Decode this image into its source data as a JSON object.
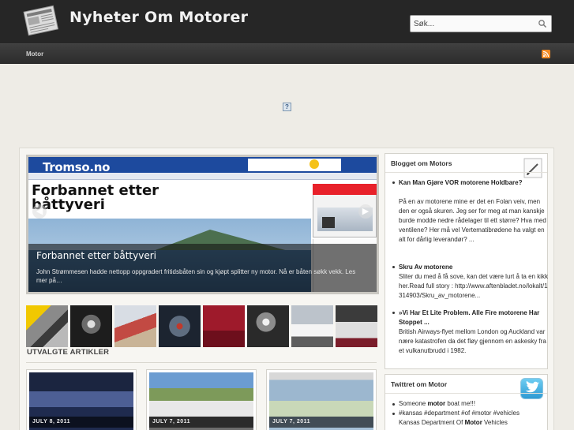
{
  "site": {
    "title": "Nyheter Om Motorer",
    "search_placeholder": "Søk...",
    "icons": {
      "logo": "newspaper-icon",
      "search": "magnifier-icon",
      "rss": "rss-icon"
    }
  },
  "nav": {
    "items": [
      {
        "label": "Motor"
      }
    ]
  },
  "slider": {
    "screenshot": {
      "brand": "Tromso.no",
      "headline": "Forbannet etter båttyveri"
    },
    "caption_title": "Forbannet etter båttyveri",
    "caption_text": "John Strømmesen hadde nettopp oppgradert fritidsbåten sin og kjøpt splitter ny motor. Nå er båten søkk vekk. Les mer på…"
  },
  "featured": {
    "heading": "UTVALGTE ARTIKLER",
    "cards": [
      {
        "date": "JULY 8, 2011"
      },
      {
        "date": "JULY 7, 2011"
      },
      {
        "date": "JULY 7, 2011"
      }
    ]
  },
  "blog_widget": {
    "title": "Blogget om Motors",
    "posts": [
      {
        "title": "Kan Man Gjøre VOR motorene Holdbare?",
        "body": "På en av motorene mine er det en Folan veiv, men den er også skuren. Jeg ser for meg at man kanskje burde modde nedre rådelager til ett større? Hva med ventilene? Her må vel Vertematibrødene ha valgt en alt for dårlig leverandør? ..."
      },
      {
        "title": "Skru Av motorene",
        "body": "Sliter du med å få sove, kan det være lurt å ta en kikk her.Read full story : http://www.aftenbladet.no/lokalt/1314903/Skru_av_motorene..."
      },
      {
        "title": "»Vi Har Et Lite Problem. Alle Fire motorene Har Stoppet ...",
        "body": "British Airways-flyet mellom London og Auckland var nære katastrofen da det fløy gjennom en askesky fra et vulkanutbrudd i 1982."
      }
    ]
  },
  "twitter_widget": {
    "title": "Twittret om Motor",
    "tweets": [
      {
        "pre": "Someone ",
        "bold": "motor",
        "post": " boat me!!!"
      },
      {
        "line1": "#kansas #department #of #motor #vehicles",
        "line2_pre": "Kansas Department Of ",
        "line2_bold": "Motor",
        "line2_post": " Vehicles"
      }
    ]
  },
  "ad": {
    "placeholder": "?"
  }
}
